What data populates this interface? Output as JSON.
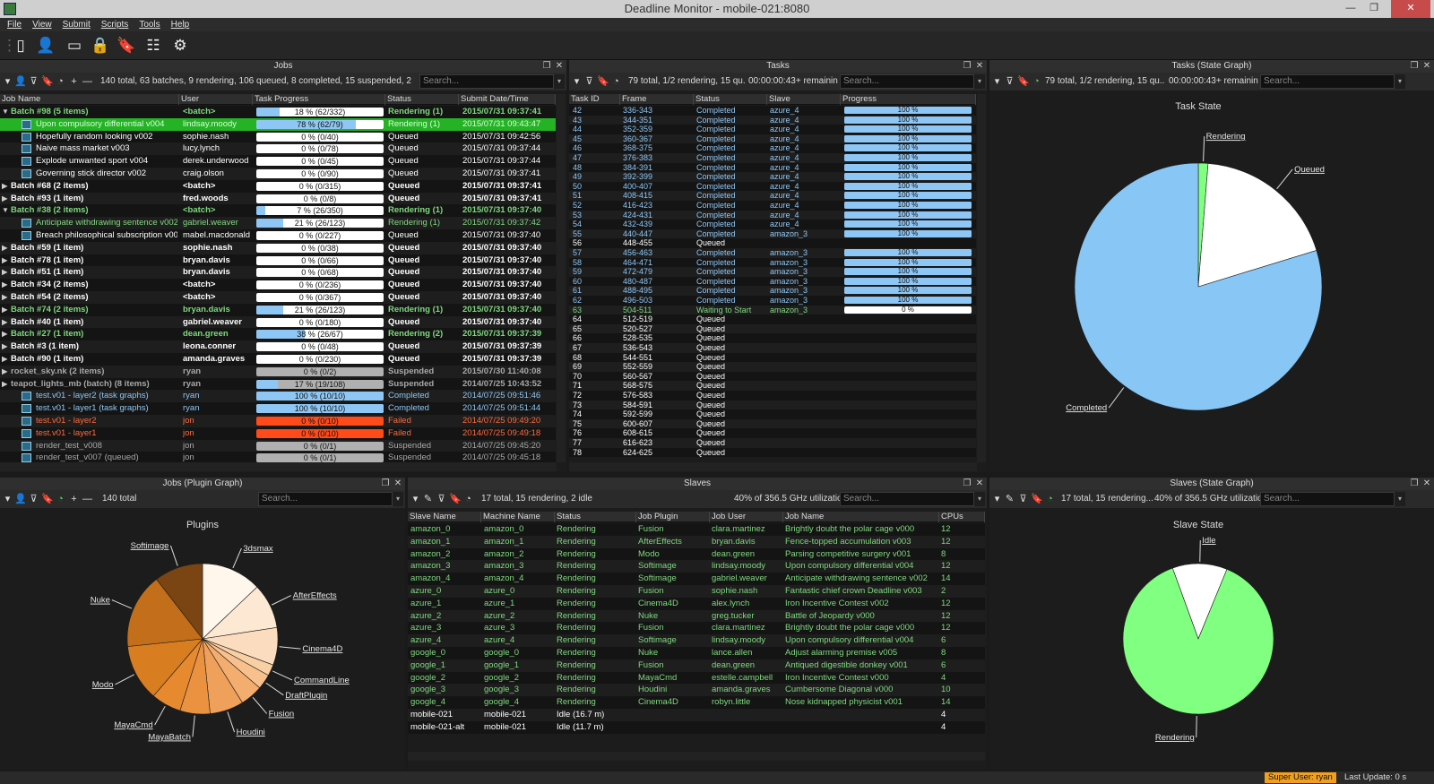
{
  "window": {
    "title": "Deadline Monitor  -  mobile-021:8080"
  },
  "menu": [
    "File",
    "View",
    "Submit",
    "Scripts",
    "Tools",
    "Help"
  ],
  "toolbar_icons": [
    "job-list-icon",
    "user-icon",
    "window-icon",
    "lock-icon",
    "bookmark-icon",
    "settings-list-icon",
    "gear-icon"
  ],
  "jobs": {
    "title": "Jobs",
    "summary": "140 total, 63 batches, 9 rendering, 106 queued, 8 completed, 15 suspended, 2 failed...",
    "search": "Search...",
    "columns": [
      "Job Name",
      "User",
      "Task Progress",
      "Status",
      "Submit Date/Time"
    ],
    "rows": [
      {
        "n": "Batch #98 (5 items)",
        "u": "<batch>",
        "p": 18,
        "pt": "18 %  (62/332)",
        "s": "Rendering (1)",
        "d": "2015/07/31 09:37:41",
        "k": "green",
        "e": "collapse",
        "ind": 0,
        "b": true
      },
      {
        "n": "Upon compulsory differential v004",
        "u": "lindsay.moody",
        "p": 78,
        "pt": "78 %  (62/79)",
        "s": "Rendering (1)",
        "d": "2015/07/31 09:43:47",
        "k": "sel",
        "ind": 1
      },
      {
        "n": "Hopefully random looking v002",
        "u": "sophie.nash",
        "p": 0,
        "pt": "0 %  (0/40)",
        "s": "Queued",
        "d": "2015/07/31 09:42:56",
        "k": "white",
        "ind": 1
      },
      {
        "n": "Naive mass market v003",
        "u": "lucy.lynch",
        "p": 0,
        "pt": "0 %  (0/78)",
        "s": "Queued",
        "d": "2015/07/31 09:37:44",
        "k": "white",
        "ind": 1
      },
      {
        "n": "Explode unwanted sport v004",
        "u": "derek.underwood",
        "p": 0,
        "pt": "0 %  (0/45)",
        "s": "Queued",
        "d": "2015/07/31 09:37:44",
        "k": "white",
        "ind": 1
      },
      {
        "n": "Governing stick director v002",
        "u": "craig.olson",
        "p": 0,
        "pt": "0 %  (0/90)",
        "s": "Queued",
        "d": "2015/07/31 09:37:41",
        "k": "white",
        "ind": 1
      },
      {
        "n": "Batch #68 (2 items)",
        "u": "<batch>",
        "p": 0,
        "pt": "0 %  (0/315)",
        "s": "Queued",
        "d": "2015/07/31 09:37:41",
        "k": "white",
        "e": "expand",
        "ind": 0,
        "b": true
      },
      {
        "n": "Batch #93 (1 item)",
        "u": "fred.woods",
        "p": 0,
        "pt": "0 %  (0/8)",
        "s": "Queued",
        "d": "2015/07/31 09:37:41",
        "k": "white",
        "e": "expand",
        "ind": 0,
        "b": true
      },
      {
        "n": "Batch #38 (2 items)",
        "u": "<batch>",
        "p": 7,
        "pt": "7 %  (26/350)",
        "s": "Rendering (1)",
        "d": "2015/07/31 09:37:40",
        "k": "green",
        "e": "collapse",
        "ind": 0,
        "b": true
      },
      {
        "n": "Anticipate withdrawing sentence v002",
        "u": "gabriel.weaver",
        "p": 21,
        "pt": "21 %  (26/123)",
        "s": "Rendering (1)",
        "d": "2015/07/31 09:37:42",
        "k": "green",
        "ind": 1
      },
      {
        "n": "Breach philosophical subscription v003",
        "u": "mabel.macdonald",
        "p": 0,
        "pt": "0 %  (0/227)",
        "s": "Queued",
        "d": "2015/07/31 09:37:40",
        "k": "white",
        "ind": 1
      },
      {
        "n": "Batch #59 (1 item)",
        "u": "sophie.nash",
        "p": 0,
        "pt": "0 %  (0/38)",
        "s": "Queued",
        "d": "2015/07/31 09:37:40",
        "k": "white",
        "e": "expand",
        "ind": 0,
        "b": true
      },
      {
        "n": "Batch #78 (1 item)",
        "u": "bryan.davis",
        "p": 0,
        "pt": "0 %  (0/66)",
        "s": "Queued",
        "d": "2015/07/31 09:37:40",
        "k": "white",
        "e": "expand",
        "ind": 0,
        "b": true
      },
      {
        "n": "Batch #51 (1 item)",
        "u": "bryan.davis",
        "p": 0,
        "pt": "0 %  (0/68)",
        "s": "Queued",
        "d": "2015/07/31 09:37:40",
        "k": "white",
        "e": "expand",
        "ind": 0,
        "b": true
      },
      {
        "n": "Batch #34 (2 items)",
        "u": "<batch>",
        "p": 0,
        "pt": "0 %  (0/236)",
        "s": "Queued",
        "d": "2015/07/31 09:37:40",
        "k": "white",
        "e": "expand",
        "ind": 0,
        "b": true
      },
      {
        "n": "Batch #54 (2 items)",
        "u": "<batch>",
        "p": 0,
        "pt": "0 %  (0/367)",
        "s": "Queued",
        "d": "2015/07/31 09:37:40",
        "k": "white",
        "e": "expand",
        "ind": 0,
        "b": true
      },
      {
        "n": "Batch #74 (2 items)",
        "u": "bryan.davis",
        "p": 21,
        "pt": "21 %  (26/123)",
        "s": "Rendering (1)",
        "d": "2015/07/31 09:37:40",
        "k": "green",
        "e": "expand",
        "ind": 0,
        "b": true
      },
      {
        "n": "Batch #40 (1 item)",
        "u": "gabriel.weaver",
        "p": 0,
        "pt": "0 %  (0/180)",
        "s": "Queued",
        "d": "2015/07/31 09:37:40",
        "k": "white",
        "e": "expand",
        "ind": 0,
        "b": true
      },
      {
        "n": "Batch #27 (1 item)",
        "u": "dean.green",
        "p": 38,
        "pt": "38 %  (26/67)",
        "s": "Rendering (2)",
        "d": "2015/07/31 09:37:39",
        "k": "green",
        "e": "expand",
        "ind": 0,
        "b": true
      },
      {
        "n": "Batch #3 (1 item)",
        "u": "leona.conner",
        "p": 0,
        "pt": "0 %  (0/48)",
        "s": "Queued",
        "d": "2015/07/31 09:37:39",
        "k": "white",
        "e": "expand",
        "ind": 0,
        "b": true
      },
      {
        "n": "Batch #90 (1 item)",
        "u": "amanda.graves",
        "p": 0,
        "pt": "0 %  (0/230)",
        "s": "Queued",
        "d": "2015/07/31 09:37:39",
        "k": "white",
        "e": "expand",
        "ind": 0,
        "b": true
      },
      {
        "n": "rocket_sky.nk (2 items)",
        "u": "ryan",
        "p": 0,
        "pt": "0 %  (0/2)",
        "s": "Suspended",
        "d": "2015/07/30 11:40:08",
        "k": "gray",
        "e": "expand",
        "ind": 0,
        "b": true,
        "bar": "gray"
      },
      {
        "n": "teapot_lights_mb  (batch) (8 items)",
        "u": "ryan",
        "p": 17,
        "pt": "17 %  (19/108)",
        "s": "Suspended",
        "d": "2014/07/25 10:43:52",
        "k": "gray",
        "e": "expand",
        "ind": 0,
        "b": true,
        "bar": "gray"
      },
      {
        "n": "test.v01 - layer2   (task graphs)",
        "u": "ryan",
        "p": 100,
        "pt": "100 %  (10/10)",
        "s": "Completed",
        "d": "2014/07/25 09:51:46",
        "k": "blue",
        "ind": 1
      },
      {
        "n": "test.v01 - layer1   (task graphs)",
        "u": "ryan",
        "p": 100,
        "pt": "100 %  (10/10)",
        "s": "Completed",
        "d": "2014/07/25 09:51:44",
        "k": "blue",
        "ind": 1
      },
      {
        "n": "test.v01 - layer2",
        "u": "jon",
        "p": 0,
        "pt": "0 %  (0/10)",
        "s": "Failed",
        "d": "2014/07/25 09:49:20",
        "k": "red",
        "ind": 1,
        "bar": "red"
      },
      {
        "n": "test.v01 - layer1",
        "u": "jon",
        "p": 0,
        "pt": "0 %  (0/10)",
        "s": "Failed",
        "d": "2014/07/25 09:49:18",
        "k": "red",
        "ind": 1,
        "bar": "red"
      },
      {
        "n": "render_test_v008",
        "u": "jon",
        "p": 0,
        "pt": "0 %  (0/1)",
        "s": "Suspended",
        "d": "2014/07/25 09:45:20",
        "k": "gray",
        "ind": 1,
        "bar": "gray"
      },
      {
        "n": "render_test_v007  (queued)",
        "u": "jon",
        "p": 0,
        "pt": "0 %  (0/1)",
        "s": "Suspended",
        "d": "2014/07/25 09:45:18",
        "k": "gray",
        "ind": 1,
        "bar": "gray"
      }
    ]
  },
  "tasks": {
    "title": "Tasks",
    "summary": "79 total, 1/2 rendering, 15 qu...",
    "remaining": "00:00:00:43+ remaining",
    "search": "Search...",
    "columns": [
      "Task ID",
      "Frame",
      "Status",
      "Slave",
      "Progress"
    ],
    "rows": [
      [
        "42",
        "336-343",
        "Completed",
        "azure_4",
        "100 %"
      ],
      [
        "43",
        "344-351",
        "Completed",
        "azure_4",
        "100 %"
      ],
      [
        "44",
        "352-359",
        "Completed",
        "azure_4",
        "100 %"
      ],
      [
        "45",
        "360-367",
        "Completed",
        "azure_4",
        "100 %"
      ],
      [
        "46",
        "368-375",
        "Completed",
        "azure_4",
        "100 %"
      ],
      [
        "47",
        "376-383",
        "Completed",
        "azure_4",
        "100 %"
      ],
      [
        "48",
        "384-391",
        "Completed",
        "azure_4",
        "100 %"
      ],
      [
        "49",
        "392-399",
        "Completed",
        "azure_4",
        "100 %"
      ],
      [
        "50",
        "400-407",
        "Completed",
        "azure_4",
        "100 %"
      ],
      [
        "51",
        "408-415",
        "Completed",
        "azure_4",
        "100 %"
      ],
      [
        "52",
        "416-423",
        "Completed",
        "azure_4",
        "100 %"
      ],
      [
        "53",
        "424-431",
        "Completed",
        "azure_4",
        "100 %"
      ],
      [
        "54",
        "432-439",
        "Completed",
        "azure_4",
        "100 %"
      ],
      [
        "55",
        "440-447",
        "Completed",
        "amazon_3",
        "100 %"
      ],
      [
        "56",
        "448-455",
        "Queued",
        "",
        ""
      ],
      [
        "57",
        "456-463",
        "Completed",
        "amazon_3",
        "100 %"
      ],
      [
        "58",
        "464-471",
        "Completed",
        "amazon_3",
        "100 %"
      ],
      [
        "59",
        "472-479",
        "Completed",
        "amazon_3",
        "100 %"
      ],
      [
        "60",
        "480-487",
        "Completed",
        "amazon_3",
        "100 %"
      ],
      [
        "61",
        "488-495",
        "Completed",
        "amazon_3",
        "100 %"
      ],
      [
        "62",
        "496-503",
        "Completed",
        "amazon_3",
        "100 %"
      ],
      [
        "63",
        "504-511",
        "Waiting to Start",
        "amazon_3",
        "0 %"
      ],
      [
        "64",
        "512-519",
        "Queued",
        "",
        ""
      ],
      [
        "65",
        "520-527",
        "Queued",
        "",
        ""
      ],
      [
        "66",
        "528-535",
        "Queued",
        "",
        ""
      ],
      [
        "67",
        "536-543",
        "Queued",
        "",
        ""
      ],
      [
        "68",
        "544-551",
        "Queued",
        "",
        ""
      ],
      [
        "69",
        "552-559",
        "Queued",
        "",
        ""
      ],
      [
        "70",
        "560-567",
        "Queued",
        "",
        ""
      ],
      [
        "71",
        "568-575",
        "Queued",
        "",
        ""
      ],
      [
        "72",
        "576-583",
        "Queued",
        "",
        ""
      ],
      [
        "73",
        "584-591",
        "Queued",
        "",
        ""
      ],
      [
        "74",
        "592-599",
        "Queued",
        "",
        ""
      ],
      [
        "75",
        "600-607",
        "Queued",
        "",
        ""
      ],
      [
        "76",
        "608-615",
        "Queued",
        "",
        ""
      ],
      [
        "77",
        "616-623",
        "Queued",
        "",
        ""
      ],
      [
        "78",
        "624-625",
        "Queued",
        "",
        ""
      ]
    ]
  },
  "task_graph": {
    "title": "Tasks (State Graph)",
    "summary": "79 total, 1/2 rendering, 15 qu...",
    "remaining": "00:00:00:43+ remaining",
    "search": "Search...",
    "chart_title": "Task State"
  },
  "jobs_graph": {
    "title": "Jobs (Plugin Graph)",
    "summary": "140 total",
    "search": "Search...",
    "chart_title": "Plugins"
  },
  "slaves": {
    "title": "Slaves",
    "summary": "17 total, 15 rendering, 2 idle",
    "util": "40% of 356.5 GHz utilization",
    "search": "Search...",
    "columns": [
      "Slave Name",
      "Machine Name",
      "Status",
      "Job Plugin",
      "Job User",
      "Job Name",
      "CPUs"
    ],
    "rows": [
      [
        "amazon_0",
        "amazon_0",
        "Rendering",
        "Fusion",
        "clara.martinez",
        "Brightly doubt the polar cage v000",
        "12"
      ],
      [
        "amazon_1",
        "amazon_1",
        "Rendering",
        "AfterEffects",
        "bryan.davis",
        "Fence-topped accumulation v003",
        "12"
      ],
      [
        "amazon_2",
        "amazon_2",
        "Rendering",
        "Modo",
        "dean.green",
        "Parsing competitive surgery v001",
        "8"
      ],
      [
        "amazon_3",
        "amazon_3",
        "Rendering",
        "Softimage",
        "lindsay.moody",
        "Upon compulsory differential v004",
        "12"
      ],
      [
        "amazon_4",
        "amazon_4",
        "Rendering",
        "Softimage",
        "gabriel.weaver",
        "Anticipate withdrawing sentence v002",
        "14"
      ],
      [
        "azure_0",
        "azure_0",
        "Rendering",
        "Fusion",
        "sophie.nash",
        "Fantastic chief crown Deadline v003",
        "2"
      ],
      [
        "azure_1",
        "azure_1",
        "Rendering",
        "Cinema4D",
        "alex.lynch",
        "Iron Incentive Contest v002",
        "12"
      ],
      [
        "azure_2",
        "azure_2",
        "Rendering",
        "Nuke",
        "greg.tucker",
        "Battle of Jeopardy v000",
        "12"
      ],
      [
        "azure_3",
        "azure_3",
        "Rendering",
        "Fusion",
        "clara.martinez",
        "Brightly doubt the polar cage v000",
        "12"
      ],
      [
        "azure_4",
        "azure_4",
        "Rendering",
        "Softimage",
        "lindsay.moody",
        "Upon compulsory differential v004",
        "6"
      ],
      [
        "google_0",
        "google_0",
        "Rendering",
        "Nuke",
        "lance.allen",
        "Adjust alarming premise v005",
        "8"
      ],
      [
        "google_1",
        "google_1",
        "Rendering",
        "Fusion",
        "dean.green",
        "Antiqued digestible donkey v001",
        "6"
      ],
      [
        "google_2",
        "google_2",
        "Rendering",
        "MayaCmd",
        "estelle.campbell",
        "Iron Incentive Contest v000",
        "4"
      ],
      [
        "google_3",
        "google_3",
        "Rendering",
        "Houdini",
        "amanda.graves",
        "Cumbersome Diagonal v000",
        "10"
      ],
      [
        "google_4",
        "google_4",
        "Rendering",
        "Cinema4D",
        "robyn.little",
        "Nose kidnapped physicist v001",
        "14"
      ],
      [
        "mobile-021",
        "mobile-021",
        "Idle (16.7 m)",
        "",
        "",
        "",
        "4"
      ],
      [
        "mobile-021-alt",
        "mobile-021",
        "Idle (11.7 m)",
        "",
        "",
        "",
        "4"
      ]
    ]
  },
  "slave_graph": {
    "title": "Slaves (State Graph)",
    "summary": "17 total, 15 rendering...",
    "util": "40% of 356.5 GHz utilization",
    "search": "Search...",
    "chart_title": "Slave State"
  },
  "status": {
    "user": "Super User: ryan",
    "last_update": "Last Update: 0 s"
  },
  "chart_data": [
    {
      "type": "pie",
      "title": "Task State",
      "labels": [
        "Rendering",
        "Queued",
        "Completed"
      ],
      "values": [
        1,
        15,
        63
      ],
      "colors": [
        "#80ff80",
        "#ffffff",
        "#87c6f5"
      ]
    },
    {
      "type": "pie",
      "title": "Plugins",
      "labels": [
        "3dsmax",
        "AfterEffects",
        "Cinema4D",
        "CommandLine",
        "DraftPlugin",
        "Fusion",
        "Houdini",
        "MayaBatch",
        "MayaCmd",
        "Modo",
        "Nuke",
        "Softimage"
      ],
      "values": [
        16,
        12,
        10,
        3,
        4,
        6,
        9,
        8,
        8,
        15,
        20,
        13
      ],
      "colors": [
        "#fff6ec",
        "#fde8d3",
        "#fbdcbe",
        "#f9cfa4",
        "#f7c08c",
        "#f3ad6e",
        "#efa05a",
        "#eb9240",
        "#e7892f",
        "#d87d20",
        "#c26e1a",
        "#7a4512"
      ]
    },
    {
      "type": "pie",
      "title": "Slave State",
      "labels": [
        "Idle",
        "Rendering"
      ],
      "values": [
        2,
        15
      ],
      "colors": [
        "#ffffff",
        "#80ff80"
      ]
    }
  ]
}
